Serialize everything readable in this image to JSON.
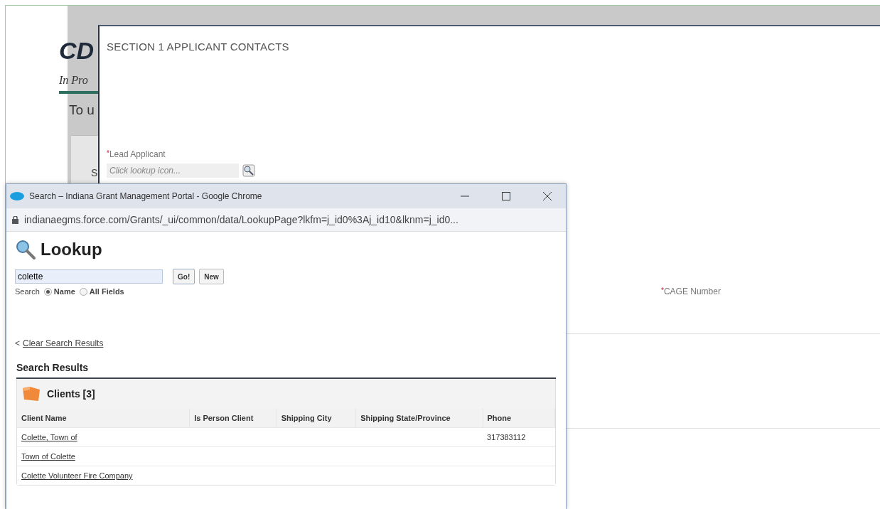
{
  "background_page": {
    "title": "CD",
    "status": "In Pro",
    "intro": "To u",
    "card_text": "S"
  },
  "modal": {
    "heading": "SECTION 1 APPLICANT CONTACTS",
    "lead_field": {
      "required_mark": "*",
      "label": "Lead Applicant",
      "placeholder": "Click lookup icon..."
    },
    "cage_field": {
      "required_mark": "*",
      "label": "CAGE Number"
    }
  },
  "popup": {
    "window_title": "Search – Indiana Grant Management Portal - Google Chrome",
    "url": "indianaegms.force.com/Grants/_ui/common/data/LookupPage?lkfm=j_id0%3Aj_id10&lknm=j_id0...",
    "page_title": "Lookup",
    "search_value": "colette",
    "buttons": [
      "Go!",
      "New"
    ],
    "search_label": "Search",
    "search_options": [
      {
        "label": "Name",
        "selected": true
      },
      {
        "label": "All Fields",
        "selected": false
      }
    ],
    "clear_prefix": "<",
    "clear_link": "Clear Search Results",
    "results_heading": "Search Results",
    "section_title": "Clients [3]",
    "columns": [
      "Client Name",
      "Is Person Client",
      "Shipping City",
      "Shipping State/Province",
      "Phone"
    ],
    "rows": [
      {
        "client_name": "Colette, Town of",
        "phone": "317383112"
      },
      {
        "client_name": "Town of Colette"
      },
      {
        "client_name": "Colette Volunteer Fire Company"
      }
    ]
  }
}
